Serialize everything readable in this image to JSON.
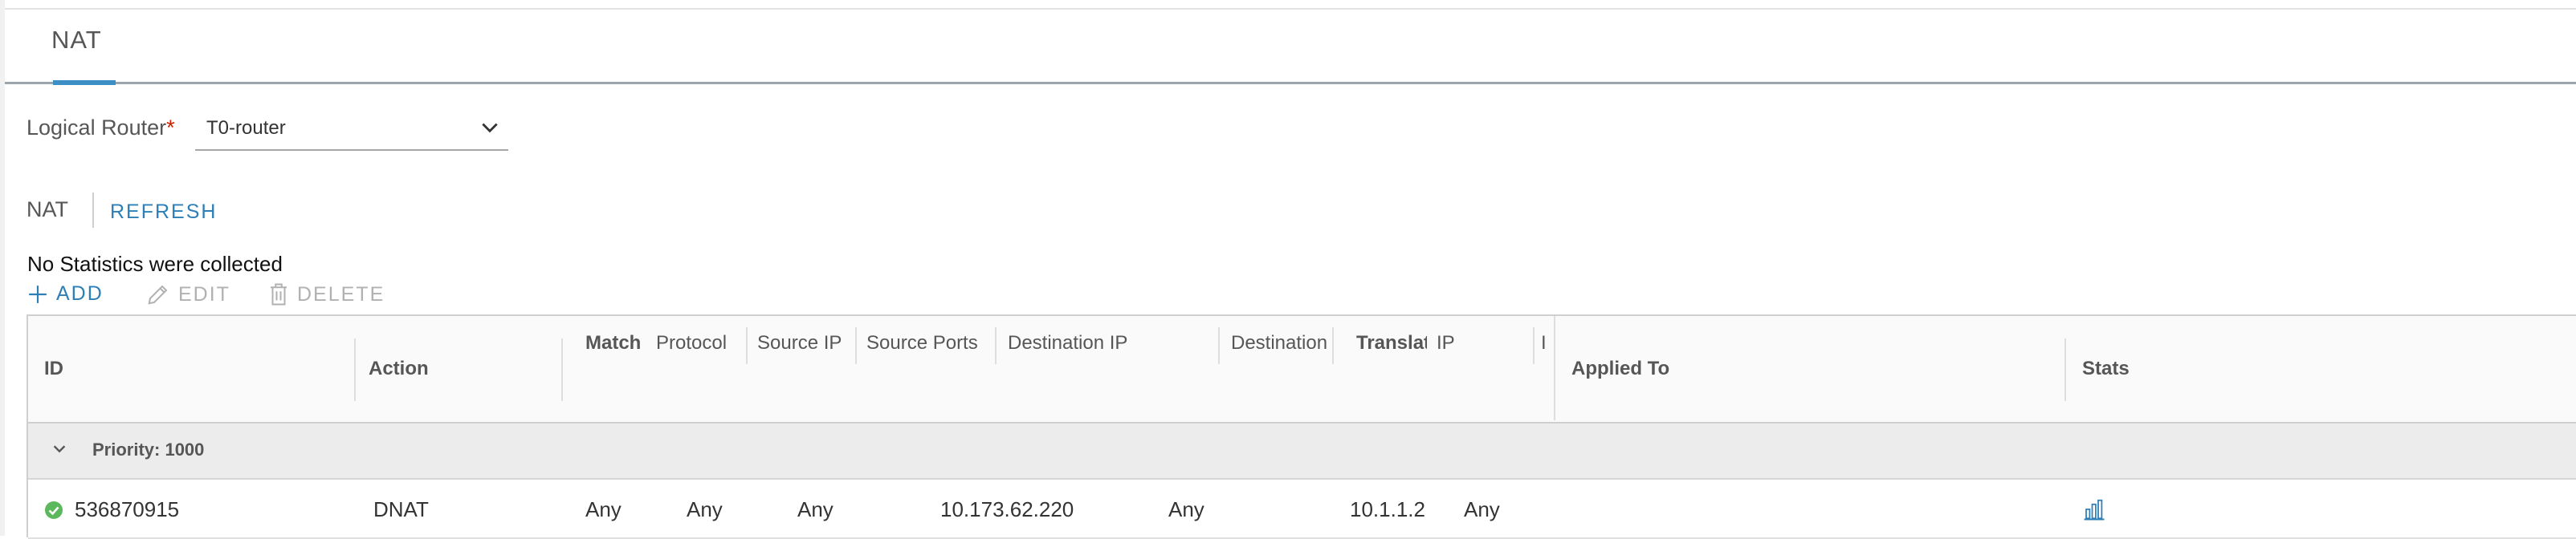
{
  "tab": {
    "label": "NAT"
  },
  "router": {
    "label": "Logical Router",
    "required_marker": "*",
    "value": "T0-router"
  },
  "nat_section": {
    "heading": "NAT",
    "refresh_label": "REFRESH"
  },
  "stats_message": "No Statistics were collected",
  "toolbar": {
    "add_label": "ADD",
    "edit_label": "EDIT",
    "delete_label": "DELETE"
  },
  "table": {
    "headers": {
      "id": "ID",
      "action": "Action",
      "match": "Match",
      "protocol": "Protocol",
      "source_ip": "Source IP",
      "source_ports": "Source Ports",
      "destination_ip": "Destination IP",
      "destination_ports": "Destination",
      "translated": "Translat",
      "translated_ip": "IP",
      "translated_ports": "I",
      "applied_to": "Applied To",
      "stats": "Stats"
    },
    "group": {
      "label": "Priority: 1000"
    },
    "rows": [
      {
        "id": "536870915",
        "action": "DNAT",
        "protocol": "Any",
        "source_ip": "Any",
        "source_ports": "Any",
        "destination_ip": "10.173.62.220",
        "destination_ports": "Any",
        "translated_ip": "10.1.1.2",
        "translated_ports": "Any",
        "status_icon": "check-circle-icon",
        "stats_icon": "bar-chart-icon"
      }
    ]
  },
  "colors": {
    "accent": "#2d7fb8",
    "ok": "#5cb85c",
    "required": "#c92100"
  }
}
